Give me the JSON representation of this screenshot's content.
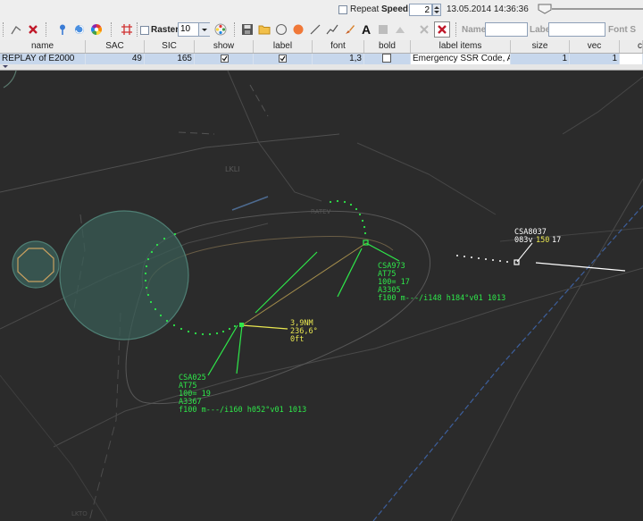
{
  "topbar": {
    "repeat_label": "Repeat",
    "speed_label": "Speed:",
    "speed_value": "2",
    "datetime": "13.05.2014 14:36:36"
  },
  "toolbar": {
    "raster_label": "Raster",
    "raster_value": "10",
    "text_button": "A",
    "name_label": "Name",
    "label_label": "Label",
    "font_label": "Font S"
  },
  "table": {
    "columns": [
      "name",
      "SAC",
      "SIC",
      "show",
      "label",
      "font",
      "bold",
      "label items",
      "size",
      "vec",
      "c"
    ],
    "row": {
      "name": "REPLAY of E2000",
      "sac": "49",
      "sic": "165",
      "show": true,
      "label": true,
      "font": "1,3",
      "bold": false,
      "label_items": "Emergency SSR Code, ACA...",
      "size": "1",
      "vec": "1"
    }
  },
  "radar": {
    "map_labels": [
      "LKLI",
      "RATEV",
      "LKTO"
    ],
    "tracks": [
      {
        "callsign": "CSA973",
        "lines": [
          "AT75",
          "100=  17",
          "A3305",
          "f100 m---/i148 h184°v01 1013"
        ]
      },
      {
        "callsign": "CSA025",
        "lines": [
          "AT75",
          "100=  19",
          "A3367",
          "f100 m---/i160 h052°v01 1013"
        ]
      },
      {
        "callsign": "CSA8037",
        "line2_a": "083v",
        "line2_b": "150",
        "line2_c": "17"
      }
    ],
    "measure": {
      "distance": "3,9NM",
      "bearing": "236,6°",
      "level": "0ft"
    },
    "colors": {
      "background": "#2b2b2b",
      "track": "#2ee84a",
      "measure": "#e8e650",
      "selected_track": "#ffffff"
    }
  }
}
